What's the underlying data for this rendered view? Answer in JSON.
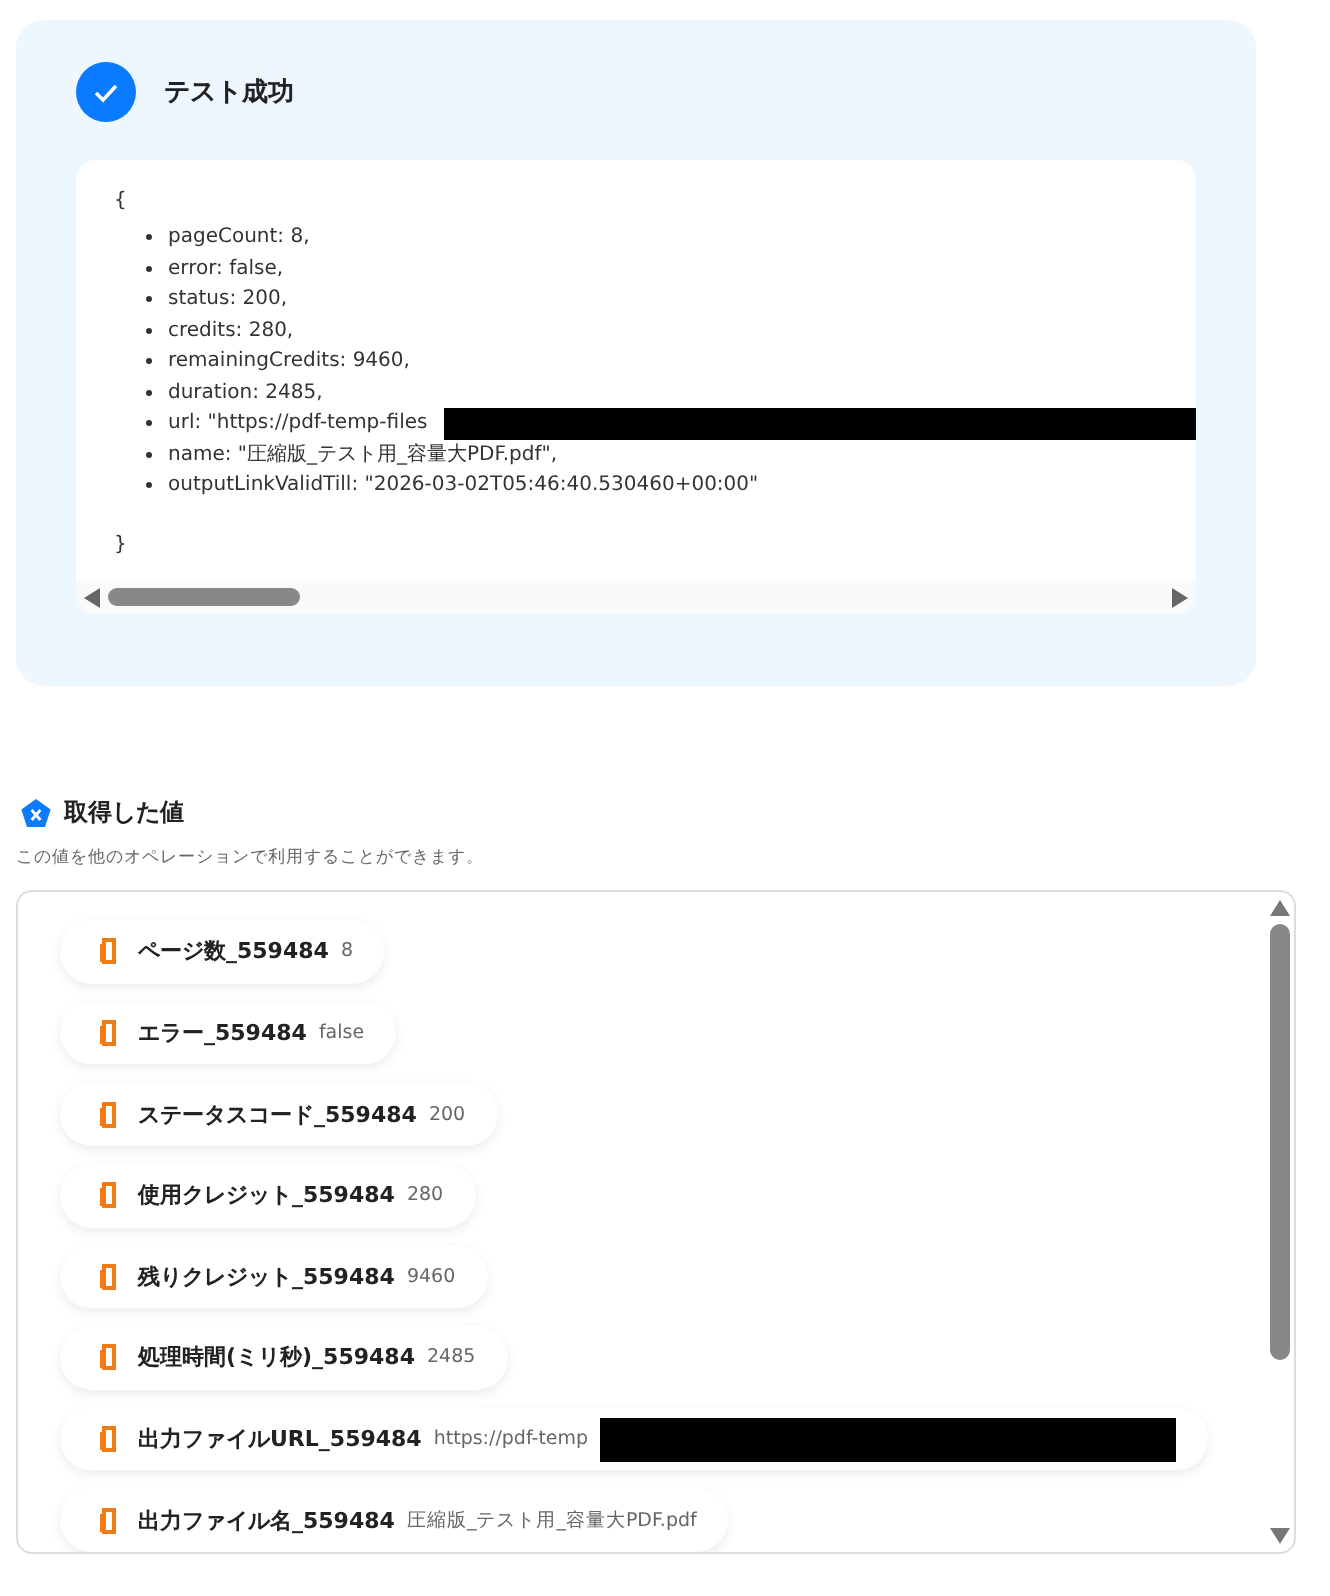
{
  "result": {
    "title": "テスト成功",
    "code": {
      "open": "{",
      "close": "}",
      "lines": [
        {
          "text": "pageCount: 8,",
          "redacted": false
        },
        {
          "text": "error: false,",
          "redacted": false
        },
        {
          "text": "status: 200,",
          "redacted": false
        },
        {
          "text": "credits: 280,",
          "redacted": false
        },
        {
          "text": "remainingCredits: 9460,",
          "redacted": false
        },
        {
          "text": "duration: 2485,",
          "redacted": false
        },
        {
          "text": "url: \"https://pdf-temp-files",
          "redacted": true
        },
        {
          "text": "name: \"圧縮版_テスト用_容量大PDF.pdf\",",
          "redacted": false
        },
        {
          "text": "outputLinkValidTill: \"2026-03-02T05:46:40.530460+00:00\"",
          "redacted": false
        }
      ]
    }
  },
  "values": {
    "title": "取得した値",
    "description": "この値を他のオペレーションで利用することができます。",
    "items": [
      {
        "name": "ページ数_559484",
        "value": "8",
        "redacted": false
      },
      {
        "name": "エラー_559484",
        "value": "false",
        "redacted": false
      },
      {
        "name": "ステータスコード_559484",
        "value": "200",
        "redacted": false
      },
      {
        "name": "使用クレジット_559484",
        "value": "280",
        "redacted": false
      },
      {
        "name": "残りクレジット_559484",
        "value": "9460",
        "redacted": false
      },
      {
        "name": "処理時間(ミリ秒)_559484",
        "value": "2485",
        "redacted": false
      },
      {
        "name": "出力ファイルURL_559484",
        "value": "https://pdf-temp",
        "redacted": true
      },
      {
        "name": "出力ファイル名_559484",
        "value": "圧縮版_テスト用_容量大PDF.pdf",
        "redacted": false
      }
    ]
  }
}
